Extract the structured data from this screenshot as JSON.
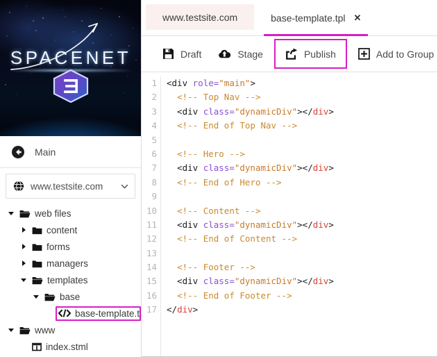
{
  "sidebar": {
    "hero": {
      "wordmark": "SPACENET",
      "badge_text": "3",
      "logo_name": "spacenet-logo"
    },
    "back": {
      "label": "Main",
      "icon": "back-arrow-circle-icon"
    },
    "site_selector": {
      "value": "www.testsite.com",
      "globe_icon": "globe-icon",
      "chevron_icon": "chevron-down-icon"
    },
    "tree": [
      {
        "label": "web files",
        "depth": 0,
        "type": "folder-open",
        "twisty": "down",
        "highlight": false
      },
      {
        "label": "content",
        "depth": 1,
        "type": "folder-closed",
        "twisty": "right",
        "highlight": false
      },
      {
        "label": "forms",
        "depth": 1,
        "type": "folder-closed",
        "twisty": "right",
        "highlight": false
      },
      {
        "label": "managers",
        "depth": 1,
        "type": "folder-closed",
        "twisty": "right",
        "highlight": false
      },
      {
        "label": "templates",
        "depth": 1,
        "type": "folder-open",
        "twisty": "down",
        "highlight": false
      },
      {
        "label": "base",
        "depth": 2,
        "type": "folder-open",
        "twisty": "down",
        "highlight": false
      },
      {
        "label": "base-template.tp",
        "depth": 3,
        "type": "code-file",
        "twisty": "none",
        "highlight": true
      },
      {
        "label": "www",
        "depth": 0,
        "type": "folder-open",
        "twisty": "down",
        "highlight": false
      },
      {
        "label": "index.stml",
        "depth": 1,
        "type": "page-file",
        "twisty": "none",
        "highlight": false
      }
    ]
  },
  "tabs": [
    {
      "label": "www.testsite.com",
      "active": false,
      "closable": false
    },
    {
      "label": "base-template.tpl",
      "active": true,
      "closable": true,
      "close_glyph": "✕"
    }
  ],
  "toolbar": [
    {
      "label": "Draft",
      "icon": "save-floppy-icon",
      "highlight": false
    },
    {
      "label": "Stage",
      "icon": "cloud-upload-icon",
      "highlight": false
    },
    {
      "label": "Publish",
      "icon": "share-export-icon",
      "highlight": true
    },
    {
      "label": "Add to Group",
      "icon": "plus-square-icon",
      "highlight": false
    }
  ],
  "editor": {
    "line_numbers": [
      "1",
      "2",
      "3",
      "4",
      "5",
      "6",
      "7",
      "8",
      "9",
      "10",
      "11",
      "12",
      "13",
      "14",
      "15",
      "16",
      "17"
    ],
    "lines": [
      [
        {
          "t": "<div ",
          "c": "tag"
        },
        {
          "t": "role=",
          "c": "attr"
        },
        {
          "t": "\"main\"",
          "c": "str"
        },
        {
          "t": ">",
          "c": "tag"
        }
      ],
      [
        {
          "t": "  ",
          "c": "tag"
        },
        {
          "t": "<!-- Top Nav -->",
          "c": "cmt"
        }
      ],
      [
        {
          "t": "  <div ",
          "c": "tag"
        },
        {
          "t": "class=",
          "c": "attr"
        },
        {
          "t": "\"dynamicDiv\"",
          "c": "str"
        },
        {
          "t": "></",
          "c": "tag"
        },
        {
          "t": "div",
          "c": "name"
        },
        {
          "t": ">",
          "c": "tag"
        }
      ],
      [
        {
          "t": "  ",
          "c": "tag"
        },
        {
          "t": "<!-- End of Top Nav -->",
          "c": "cmt"
        }
      ],
      [
        {
          "t": "",
          "c": "tag"
        }
      ],
      [
        {
          "t": "  ",
          "c": "tag"
        },
        {
          "t": "<!-- Hero -->",
          "c": "cmt"
        }
      ],
      [
        {
          "t": "  <div ",
          "c": "tag"
        },
        {
          "t": "class=",
          "c": "attr"
        },
        {
          "t": "\"dynamicDiv\"",
          "c": "str"
        },
        {
          "t": "></",
          "c": "tag"
        },
        {
          "t": "div",
          "c": "name"
        },
        {
          "t": ">",
          "c": "tag"
        }
      ],
      [
        {
          "t": "  ",
          "c": "tag"
        },
        {
          "t": "<!-- End of Hero -->",
          "c": "cmt"
        }
      ],
      [
        {
          "t": "",
          "c": "tag"
        }
      ],
      [
        {
          "t": "  ",
          "c": "tag"
        },
        {
          "t": "<!-- Content -->",
          "c": "cmt"
        }
      ],
      [
        {
          "t": "  <div ",
          "c": "tag"
        },
        {
          "t": "class=",
          "c": "attr"
        },
        {
          "t": "\"dynamicDiv\"",
          "c": "str"
        },
        {
          "t": "></",
          "c": "tag"
        },
        {
          "t": "div",
          "c": "name"
        },
        {
          "t": ">",
          "c": "tag"
        }
      ],
      [
        {
          "t": "  ",
          "c": "tag"
        },
        {
          "t": "<!-- End of Content -->",
          "c": "cmt"
        }
      ],
      [
        {
          "t": "",
          "c": "tag"
        }
      ],
      [
        {
          "t": "  ",
          "c": "tag"
        },
        {
          "t": "<!-- Footer -->",
          "c": "cmt"
        }
      ],
      [
        {
          "t": "  <div ",
          "c": "tag"
        },
        {
          "t": "class=",
          "c": "attr"
        },
        {
          "t": "\"dynamicDiv\"",
          "c": "str"
        },
        {
          "t": "></",
          "c": "tag"
        },
        {
          "t": "div",
          "c": "name"
        },
        {
          "t": ">",
          "c": "tag"
        }
      ],
      [
        {
          "t": "  ",
          "c": "tag"
        },
        {
          "t": "<!-- End of Footer -->",
          "c": "cmt"
        }
      ],
      [
        {
          "t": "</",
          "c": "tag"
        },
        {
          "t": "div",
          "c": "name"
        },
        {
          "t": ">",
          "c": "tag"
        }
      ]
    ]
  },
  "colors": {
    "highlight_magenta": "#d81ec6",
    "tab_inactive_bg": "#fbf0f0",
    "code_tag": "#1b1b1b",
    "code_tagname": "#d64232",
    "code_attr": "#8a4fd4",
    "code_string": "#c77a2a",
    "code_comment": "#c98a2e"
  }
}
